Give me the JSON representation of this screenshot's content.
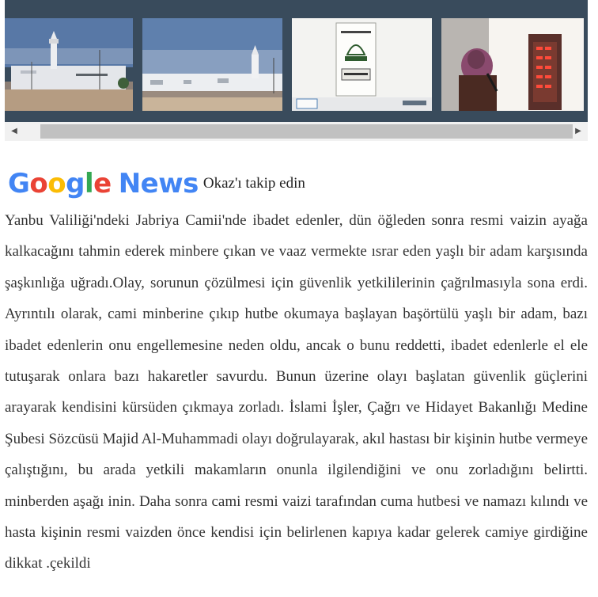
{
  "gallery": {
    "images": [
      {
        "label": "mosque-exterior-minaret"
      },
      {
        "label": "mosque-exterior-wide"
      },
      {
        "label": "mosque-sign-plaque"
      },
      {
        "label": "interior-minbar-person"
      }
    ],
    "scroll_left_icon": "triangle-left",
    "scroll_right_icon": "triangle-right"
  },
  "google_news": {
    "logo_google": "Google",
    "logo_news": "News",
    "follow_text": "Okaz'ı takip edin",
    "colors": {
      "blue": "#4285F4",
      "red": "#EA4335",
      "yellow": "#FBBC05",
      "green": "#34A853"
    }
  },
  "article": {
    "body": "Yanbu Valiliği'ndeki Jabriya Camii'nde ibadet edenler, dün öğleden sonra resmi vaizin ayağa kalkacağını tahmin ederek minbere çıkan ve vaaz vermekte ısrar eden yaşlı bir adam karşısında şaşkınlığa uğradı.Olay, sorunun çözülmesi için güvenlik yetkililerinin çağrılmasıyla sona erdi. Ayrıntılı olarak, cami minberine çıkıp hutbe okumaya başlayan başörtülü yaşlı bir adam, bazı ibadet edenlerin onu engellemesine neden oldu, ancak o bunu reddetti, ibadet edenlerle el ele tutuşarak onlara bazı hakaretler savurdu. Bunun üzerine olayı başlatan güvenlik güçlerini arayarak kendisini kürsüden çıkmaya zorladı. İslami İşler, Çağrı ve Hidayet Bakanlığı Medine Şubesi Sözcüsü Majid Al-Muhammadi olayı doğrulayarak, akıl hastası bir kişinin hutbe vermeye çalıştığını, bu arada yetkili makamların onunla ilgilendiğini ve onu zorladığını belirtti. minberden aşağı inin. Daha sonra cami resmi vaizi tarafından cuma hutbesi ve namazı kılındı ve hasta kişinin resmi vaizden önce kendisi için belirlenen kapıya kadar gelerek camiye girdiğine dikkat .çekildi"
  }
}
